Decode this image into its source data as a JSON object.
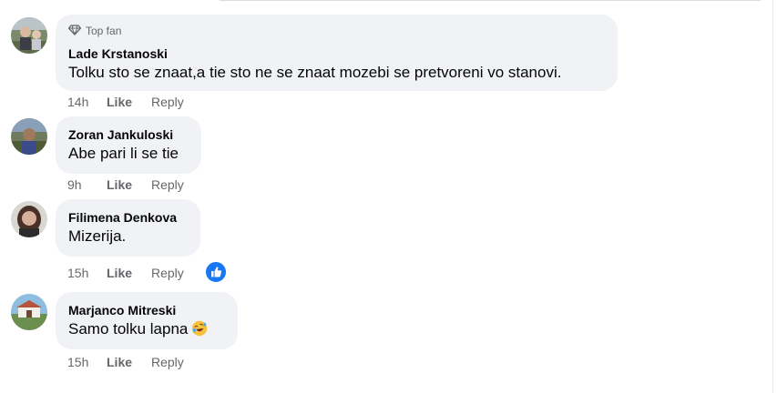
{
  "comments": [
    {
      "badge": "Top fan",
      "author": "Lade Krstanoski",
      "text": "Tolku sto se znaat,a tie sto ne se znaat mozebi se pretvoreni vo stanovi.",
      "time": "14h",
      "like": "Like",
      "reply": "Reply"
    },
    {
      "author": "Zoran Jankuloski",
      "text": "Abe pari li se tie",
      "time": "9h",
      "like": "Like",
      "reply": "Reply"
    },
    {
      "author": "Filimena Denkova",
      "text": "Mizerija.",
      "time": "15h",
      "like": "Like",
      "reply": "Reply",
      "reaction": "like-reaction-icon"
    },
    {
      "author": "Marjanco Mitreski",
      "text": "Samo tolku lapna",
      "emoji": "rolling-on-floor-laughing-emoji",
      "time": "15h",
      "like": "Like",
      "reply": "Reply"
    }
  ],
  "colors": {
    "bubble": "#f0f2f5",
    "secondary_text": "#65676b",
    "primary_text": "#050505",
    "like_blue": "#1877f2"
  }
}
